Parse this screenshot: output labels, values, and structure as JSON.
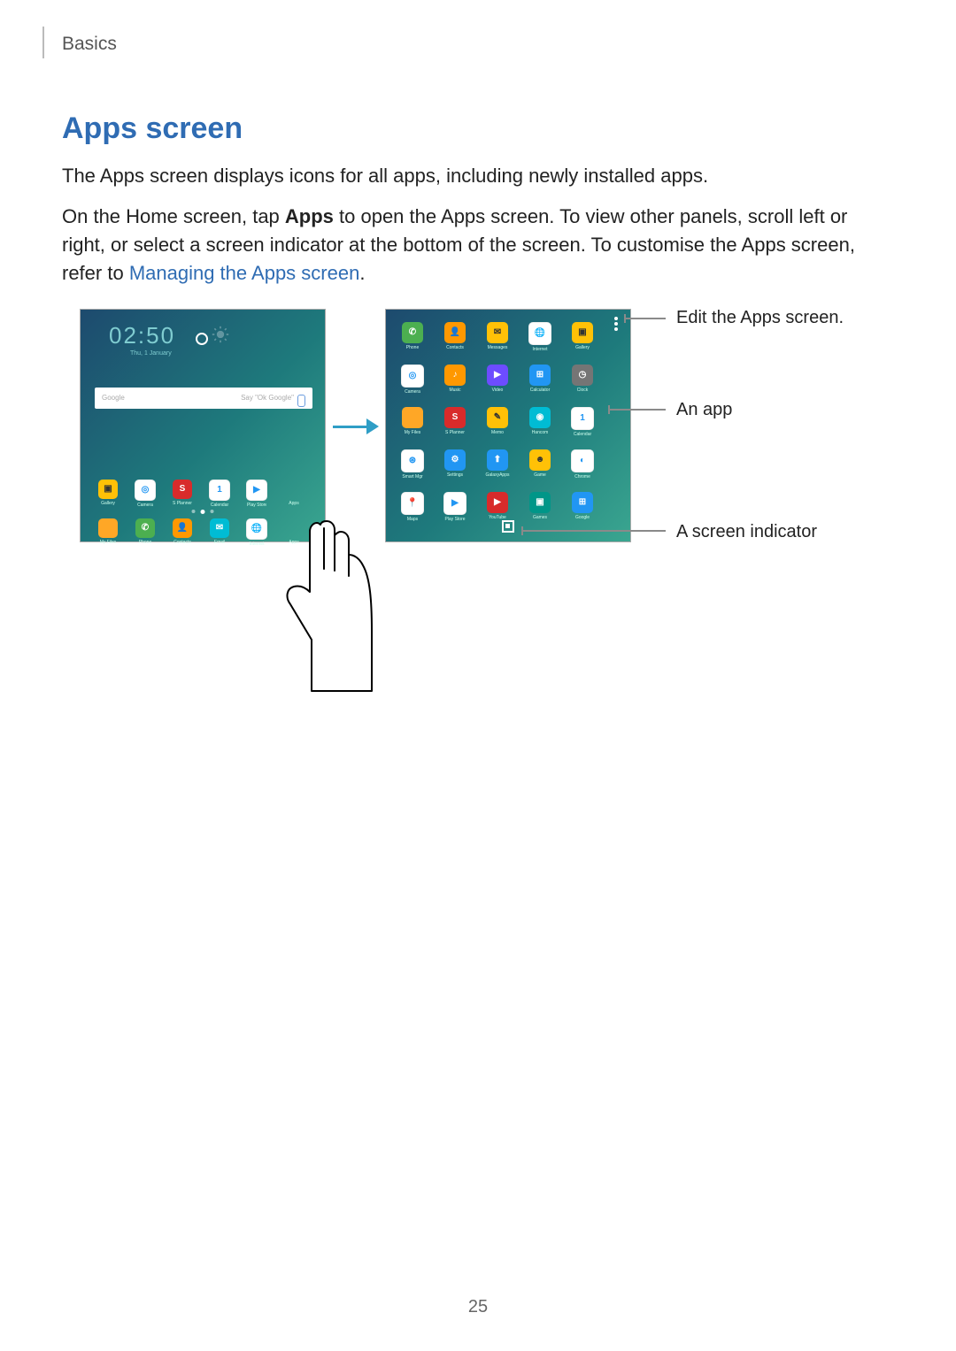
{
  "header": {
    "section": "Basics"
  },
  "title": "Apps screen",
  "paragraphs": {
    "p1": "The Apps screen displays icons for all apps, including newly installed apps.",
    "p2_pre": "On the Home screen, tap ",
    "p2_bold": "Apps",
    "p2_post": " to open the Apps screen. To view other panels, scroll left or right, or select a screen indicator at the bottom of the screen. To customise the Apps screen, refer to ",
    "p2_link": "Managing the Apps screen",
    "p2_end": "."
  },
  "callouts": {
    "edit": "Edit the Apps screen.",
    "app": "An app",
    "indicator": "A screen indicator"
  },
  "home_screen": {
    "clock": "02:50",
    "clock_sub": "Thu, 1 January",
    "search_left": "Google",
    "search_right": "Say \"Ok Google\"",
    "dock_row1": [
      {
        "name": "gallery-icon",
        "label": "Gallery",
        "cls": "c-yellow",
        "glyph": "▣"
      },
      {
        "name": "camera-icon",
        "label": "Camera",
        "cls": "c-white",
        "glyph": "◎"
      },
      {
        "name": "s-planner-icon",
        "label": "S Planner",
        "cls": "c-red",
        "glyph": "S"
      },
      {
        "name": "calendar-icon",
        "label": "Calendar",
        "cls": "c-white",
        "glyph": "1"
      },
      {
        "name": "play-store-icon",
        "label": "Play Store",
        "cls": "c-white",
        "glyph": "▶"
      },
      {
        "name": "apps-icon",
        "label": "Apps",
        "cls": "",
        "glyph": ""
      }
    ],
    "dock_row2": [
      {
        "name": "my-files-icon",
        "label": "My Files",
        "cls": "c-folder",
        "glyph": ""
      },
      {
        "name": "phone-icon",
        "label": "Phone",
        "cls": "c-green",
        "glyph": "✆"
      },
      {
        "name": "contacts-icon",
        "label": "Contacts",
        "cls": "c-orange",
        "glyph": "👤"
      },
      {
        "name": "email-icon",
        "label": "Email",
        "cls": "c-cyan",
        "glyph": "✉"
      },
      {
        "name": "internet-icon",
        "label": "Internet",
        "cls": "c-white",
        "glyph": "🌐"
      },
      {
        "name": "apps-drawer-icon",
        "label": "Apps",
        "cls": "",
        "glyph": "⋮⋮"
      }
    ]
  },
  "apps_screen": {
    "grid": [
      [
        {
          "name": "phone-icon",
          "label": "Phone",
          "cls": "c-green",
          "glyph": "✆"
        },
        {
          "name": "contacts-icon",
          "label": "Contacts",
          "cls": "c-orange",
          "glyph": "👤"
        },
        {
          "name": "messages-icon",
          "label": "Messages",
          "cls": "c-yellow",
          "glyph": "✉"
        },
        {
          "name": "internet-icon",
          "label": "Internet",
          "cls": "c-white",
          "glyph": "🌐"
        },
        {
          "name": "gallery-icon",
          "label": "Gallery",
          "cls": "c-yellow",
          "glyph": "▣"
        }
      ],
      [
        {
          "name": "camera-icon",
          "label": "Camera",
          "cls": "c-white",
          "glyph": "◎"
        },
        {
          "name": "music-icon",
          "label": "Music",
          "cls": "c-orange",
          "glyph": "♪"
        },
        {
          "name": "video-icon",
          "label": "Video",
          "cls": "c-purple",
          "glyph": "▶"
        },
        {
          "name": "calculator-icon",
          "label": "Calculator",
          "cls": "c-blue",
          "glyph": "⊞"
        },
        {
          "name": "clock-icon",
          "label": "Clock",
          "cls": "c-grey",
          "glyph": "◷"
        }
      ],
      [
        {
          "name": "my-files-icon",
          "label": "My Files",
          "cls": "c-folder",
          "glyph": ""
        },
        {
          "name": "s-planner-icon",
          "label": "S Planner",
          "cls": "c-red",
          "glyph": "S"
        },
        {
          "name": "memo-icon",
          "label": "Memo",
          "cls": "c-yellow",
          "glyph": "✎"
        },
        {
          "name": "hancom-icon",
          "label": "Hancom",
          "cls": "c-cyan",
          "glyph": "◉"
        },
        {
          "name": "calendar-icon",
          "label": "Calendar",
          "cls": "c-white",
          "glyph": "1"
        }
      ],
      [
        {
          "name": "smart-manager-icon",
          "label": "Smart Mgr",
          "cls": "c-white",
          "glyph": "⊛"
        },
        {
          "name": "settings-icon",
          "label": "Settings",
          "cls": "c-blue",
          "glyph": "⚙"
        },
        {
          "name": "galaxy-apps-icon",
          "label": "GalaxyApps",
          "cls": "c-blue",
          "glyph": "⬆"
        },
        {
          "name": "game-icon",
          "label": "Game",
          "cls": "c-yellow",
          "glyph": "☻"
        },
        {
          "name": "chrome-icon",
          "label": "Chrome",
          "cls": "c-white",
          "glyph": "◐"
        }
      ],
      [
        {
          "name": "maps-icon",
          "label": "Maps",
          "cls": "c-white",
          "glyph": "📍"
        },
        {
          "name": "play-store-icon",
          "label": "Play Store",
          "cls": "c-white",
          "glyph": "▶"
        },
        {
          "name": "youtube-icon",
          "label": "YouTube",
          "cls": "c-red",
          "glyph": "▶"
        },
        {
          "name": "play-games-icon",
          "label": "Games",
          "cls": "c-teal",
          "glyph": "▣"
        },
        {
          "name": "google-folder-icon",
          "label": "Google",
          "cls": "c-blue",
          "glyph": "⊞"
        }
      ]
    ]
  },
  "page_number": "25"
}
